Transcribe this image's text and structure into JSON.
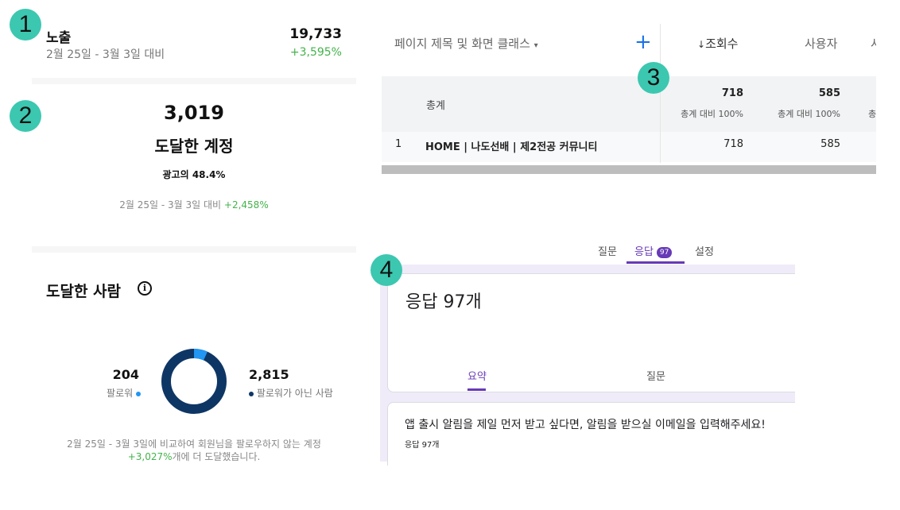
{
  "badges": [
    "1",
    "2",
    "3",
    "4"
  ],
  "colors": {
    "green": "#43b34a",
    "purple": "#673ab7",
    "blue": "#1a73e8",
    "teal": "#3cc7b0",
    "navy": "#0e3665",
    "light_blue": "#2196f3"
  },
  "impressions": {
    "title": "노출",
    "date_range": "2월 25일 - 3월 3일 대비",
    "value": "19,733",
    "change": "+3,595%"
  },
  "accounts_reached": {
    "value": "3,019",
    "label": "도달한 계정",
    "ad_prefix": "광고의 ",
    "ad_pct": "48.4%",
    "date_range": "2월 25일 - 3월 3일 대비 ",
    "change": "+2,458%"
  },
  "people_reached": {
    "title": "도달한 사람",
    "info_icon": "info-icon",
    "followers": {
      "value": "204",
      "label": "팔로워",
      "fraction": 0.068
    },
    "non_followers": {
      "value": "2,815",
      "label": "팔로워가 아닌 사람",
      "fraction": 0.932
    },
    "note_line1": "2월 25일 - 3월 3일에 비교하여 회원님을 팔로우하지 않는 계정",
    "note_change": "+3,027%",
    "note_suffix": "개에 더 도달했습니다."
  },
  "analytics": {
    "dimension_header": "페이지 제목 및 화면 클래스",
    "dimension_dropdown_icon": "caret-down-icon",
    "add_icon": "plus-icon",
    "col_views": "조회수",
    "col_views_sort_icon": "arrow-down-icon",
    "col_users": "사용자",
    "col_cut": "사",
    "total_label": "총계",
    "total_views": "718",
    "total_views_pct": "총계 대비 100%",
    "total_users": "585",
    "total_users_pct": "총계 대비 100%",
    "total_cut": "총",
    "rows": [
      {
        "index": "1",
        "title": "HOME | 나도선배 | 제2전공 커뮤니티",
        "views": "718",
        "users": "585"
      }
    ]
  },
  "forms": {
    "tabs": [
      {
        "label": "질문"
      },
      {
        "label": "응답",
        "count": "97"
      },
      {
        "label": "설정"
      }
    ],
    "response_title": "응답 97개",
    "subtabs": [
      "요약",
      "질문"
    ],
    "question": "앱 출시 알림을 제일 먼저 받고 싶다면, 알림을 받으실 이메일을 입력해주세요!",
    "question_count": "응답 97개"
  }
}
